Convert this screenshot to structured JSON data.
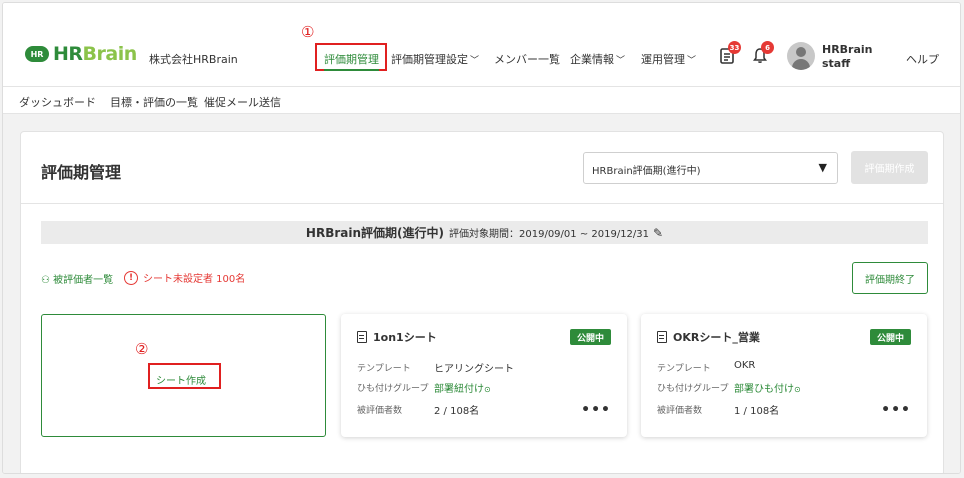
{
  "header": {
    "logo_badge": "HR",
    "logo_prefix": "HR",
    "logo_suffix": "Brain",
    "company": "株式会社HRBrain",
    "nav": [
      {
        "label": "評価期管理",
        "active": true
      },
      {
        "label": "評価期管理設定",
        "dropdown": true
      },
      {
        "label": "メンバー一覧"
      },
      {
        "label": "企業情報",
        "dropdown": true
      },
      {
        "label": "運用管理",
        "dropdown": true
      }
    ],
    "notifications": [
      {
        "icon": "clipboard-icon",
        "count": "33"
      },
      {
        "icon": "bell-icon",
        "count": "6"
      }
    ],
    "user": {
      "line1": "HRBrain",
      "line2": "staff"
    },
    "help": "ヘルプ",
    "annotation_1": "①"
  },
  "subnav": {
    "items": [
      "ダッシュボード",
      "目標・評価の一覧",
      "催促メール送信"
    ]
  },
  "page": {
    "title": "評価期管理",
    "period_select": "HRBrain評価期(進行中)",
    "create_button": "評価期作成",
    "period_name": "HRBrain評価期(進行中)",
    "period_range": "評価対象期間：2019/09/01 ~ 2019/12/31",
    "evaluatee_list": "被評価者一覧",
    "unset_warning": "シート未設定者 100名",
    "end_button": "評価期終了",
    "new_sheet": "シート作成",
    "annotation_2": "②"
  },
  "sheets": [
    {
      "title": "1on1シート",
      "status": "公開中",
      "template_label": "テンプレート",
      "template": "ヒアリングシート",
      "group_label": "ひも付けグループ",
      "group": "部署紐付け",
      "count_label": "被評価者数",
      "count": "2 / 108名"
    },
    {
      "title": "OKRシート_営業",
      "status": "公開中",
      "template_label": "テンプレート",
      "template": "OKR",
      "group_label": "ひも付けグループ",
      "group": "部署ひも付け",
      "count_label": "被評価者数",
      "count": "1 / 108名"
    }
  ],
  "colors": {
    "accent": "#2e8b3a",
    "warning": "#e53935",
    "annotation": "#e02020"
  }
}
